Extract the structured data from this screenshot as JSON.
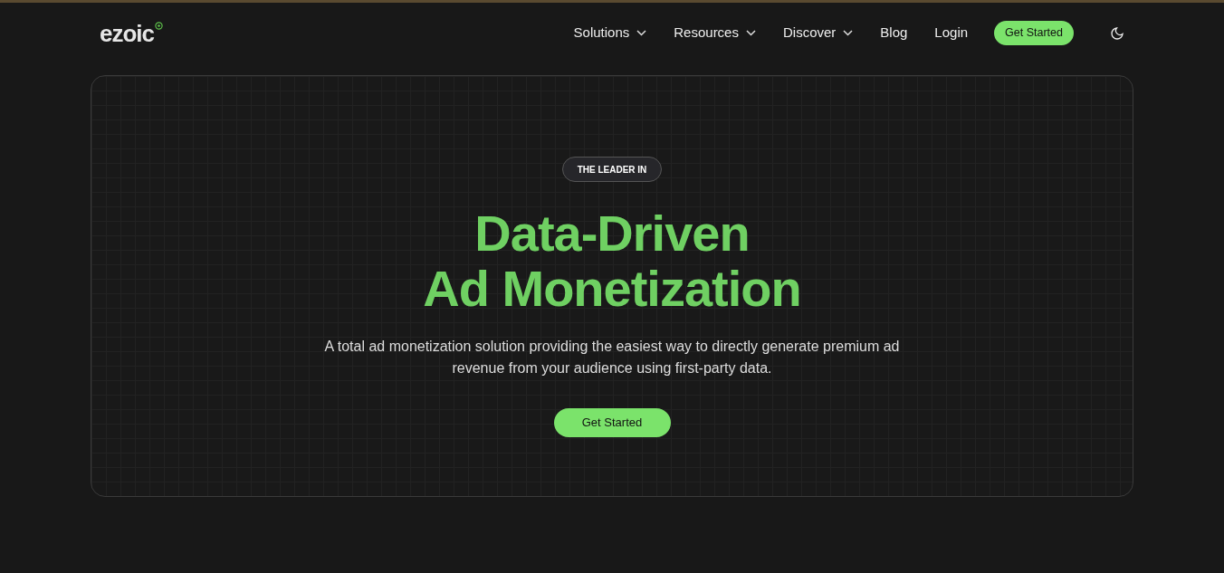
{
  "header": {
    "logo": "ezoic",
    "nav": [
      {
        "label": "Solutions",
        "dropdown": true
      },
      {
        "label": "Resources",
        "dropdown": true
      },
      {
        "label": "Discover",
        "dropdown": true
      },
      {
        "label": "Blog",
        "dropdown": false
      },
      {
        "label": "Login",
        "dropdown": false
      }
    ],
    "cta": "Get Started"
  },
  "hero": {
    "badge": "THE LEADER IN",
    "title_lines": [
      "Data-Driven",
      "Ad Monetization"
    ],
    "description": "A total ad monetization solution providing the easiest way to directly generate premium ad revenue from your audience using first-party data.",
    "cta": "Get Started"
  }
}
